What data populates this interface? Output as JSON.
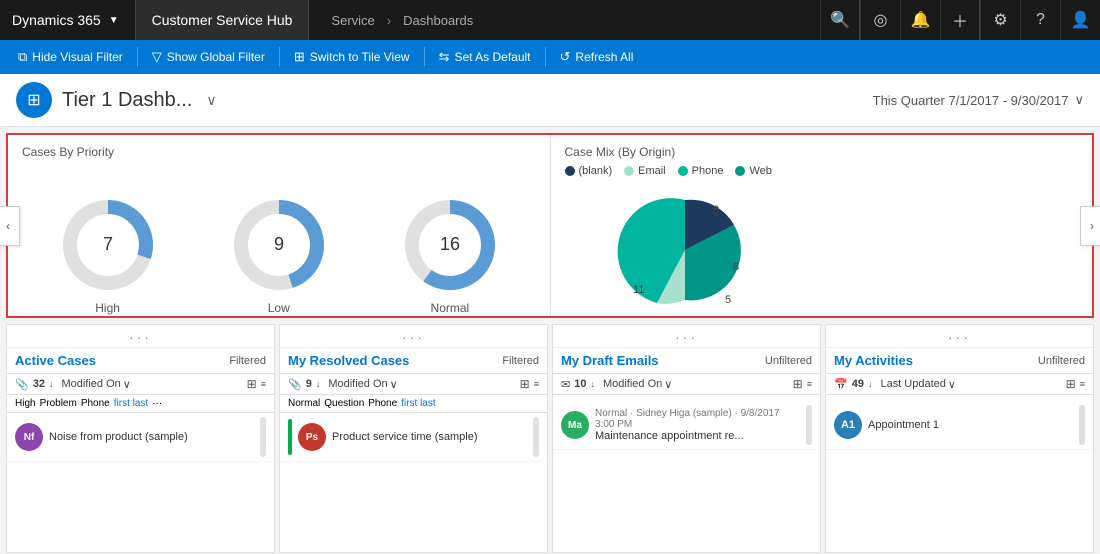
{
  "topnav": {
    "dynamics_label": "Dynamics 365",
    "hub_label": "Customer Service Hub",
    "service_label": "Service",
    "arrow": "›",
    "dashboards_label": "Dashboards"
  },
  "toolbar": {
    "hide_visual_filter": "Hide Visual Filter",
    "show_global_filter": "Show Global Filter",
    "switch_view": "Switch to Tile View",
    "set_default": "Set As Default",
    "refresh_all": "Refresh All"
  },
  "dashboard": {
    "title": "Tier 1 Dashb...",
    "date_range": "This Quarter 7/1/2017 - 9/30/2017"
  },
  "charts": {
    "cases_by_priority": {
      "title": "Cases By Priority",
      "donuts": [
        {
          "label": "High",
          "value": 7,
          "pct": 30
        },
        {
          "label": "Low",
          "value": 9,
          "pct": 45
        },
        {
          "label": "Normal",
          "value": 16,
          "pct": 60
        }
      ]
    },
    "case_mix": {
      "title": "Case Mix (By Origin)",
      "legend": [
        {
          "label": "(blank)",
          "color": "#1e3a5f"
        },
        {
          "label": "Email",
          "color": "#a8e0d0"
        },
        {
          "label": "Phone",
          "color": "#00b4a0"
        },
        {
          "label": "Web",
          "color": "#009688"
        }
      ],
      "segments": [
        {
          "label": "8",
          "value": 8,
          "color": "#1e3a5f",
          "startAngle": 0,
          "endAngle": 103
        },
        {
          "label": "8",
          "value": 8,
          "color": "#009688",
          "startAngle": 103,
          "endAngle": 205
        },
        {
          "label": "5",
          "value": 5,
          "color": "#a8e0d0",
          "startAngle": 205,
          "endAngle": 269
        },
        {
          "label": "11",
          "value": 11,
          "color": "#00b4a0",
          "startAngle": 269,
          "endAngle": 360
        }
      ]
    }
  },
  "panels": [
    {
      "id": "active-cases",
      "title": "Active Cases",
      "filter_status": "Filtered",
      "count": 32,
      "sort_by": "Modified On",
      "tags": [
        "High",
        "Problem",
        "Phone",
        "first last"
      ],
      "rows": [
        {
          "avatar_text": "Nf",
          "avatar_color": "#8e44ad",
          "title": "Noise from product (sample)",
          "sub": ""
        }
      ]
    },
    {
      "id": "my-resolved-cases",
      "title": "My Resolved Cases",
      "filter_status": "Filtered",
      "count": 9,
      "sort_by": "Modified On",
      "tags": [
        "Normal",
        "Question",
        "Phone",
        "first last"
      ],
      "rows": [
        {
          "avatar_text": "Ps",
          "avatar_color": "#c0392b",
          "title": "Product service time (sample)",
          "sub": ""
        }
      ]
    },
    {
      "id": "my-draft-emails",
      "title": "My Draft Emails",
      "filter_status": "Unfiltered",
      "count": 10,
      "sort_by": "Modified On",
      "tags": [],
      "rows": [
        {
          "avatar_text": "Ma",
          "avatar_color": "#27ae60",
          "title": "Maintenance appointment re...",
          "sub": "Normal  Sidney Higa (sample)  9/8/2017 3:00 PM"
        }
      ]
    },
    {
      "id": "my-activities",
      "title": "My Activities",
      "filter_status": "Unfiltered",
      "count": 49,
      "sort_by": "Last Updated",
      "tags": [],
      "rows": [
        {
          "avatar_text": "A1",
          "avatar_color": "#2980b9",
          "title": "Appointment 1",
          "sub": ""
        }
      ]
    }
  ]
}
